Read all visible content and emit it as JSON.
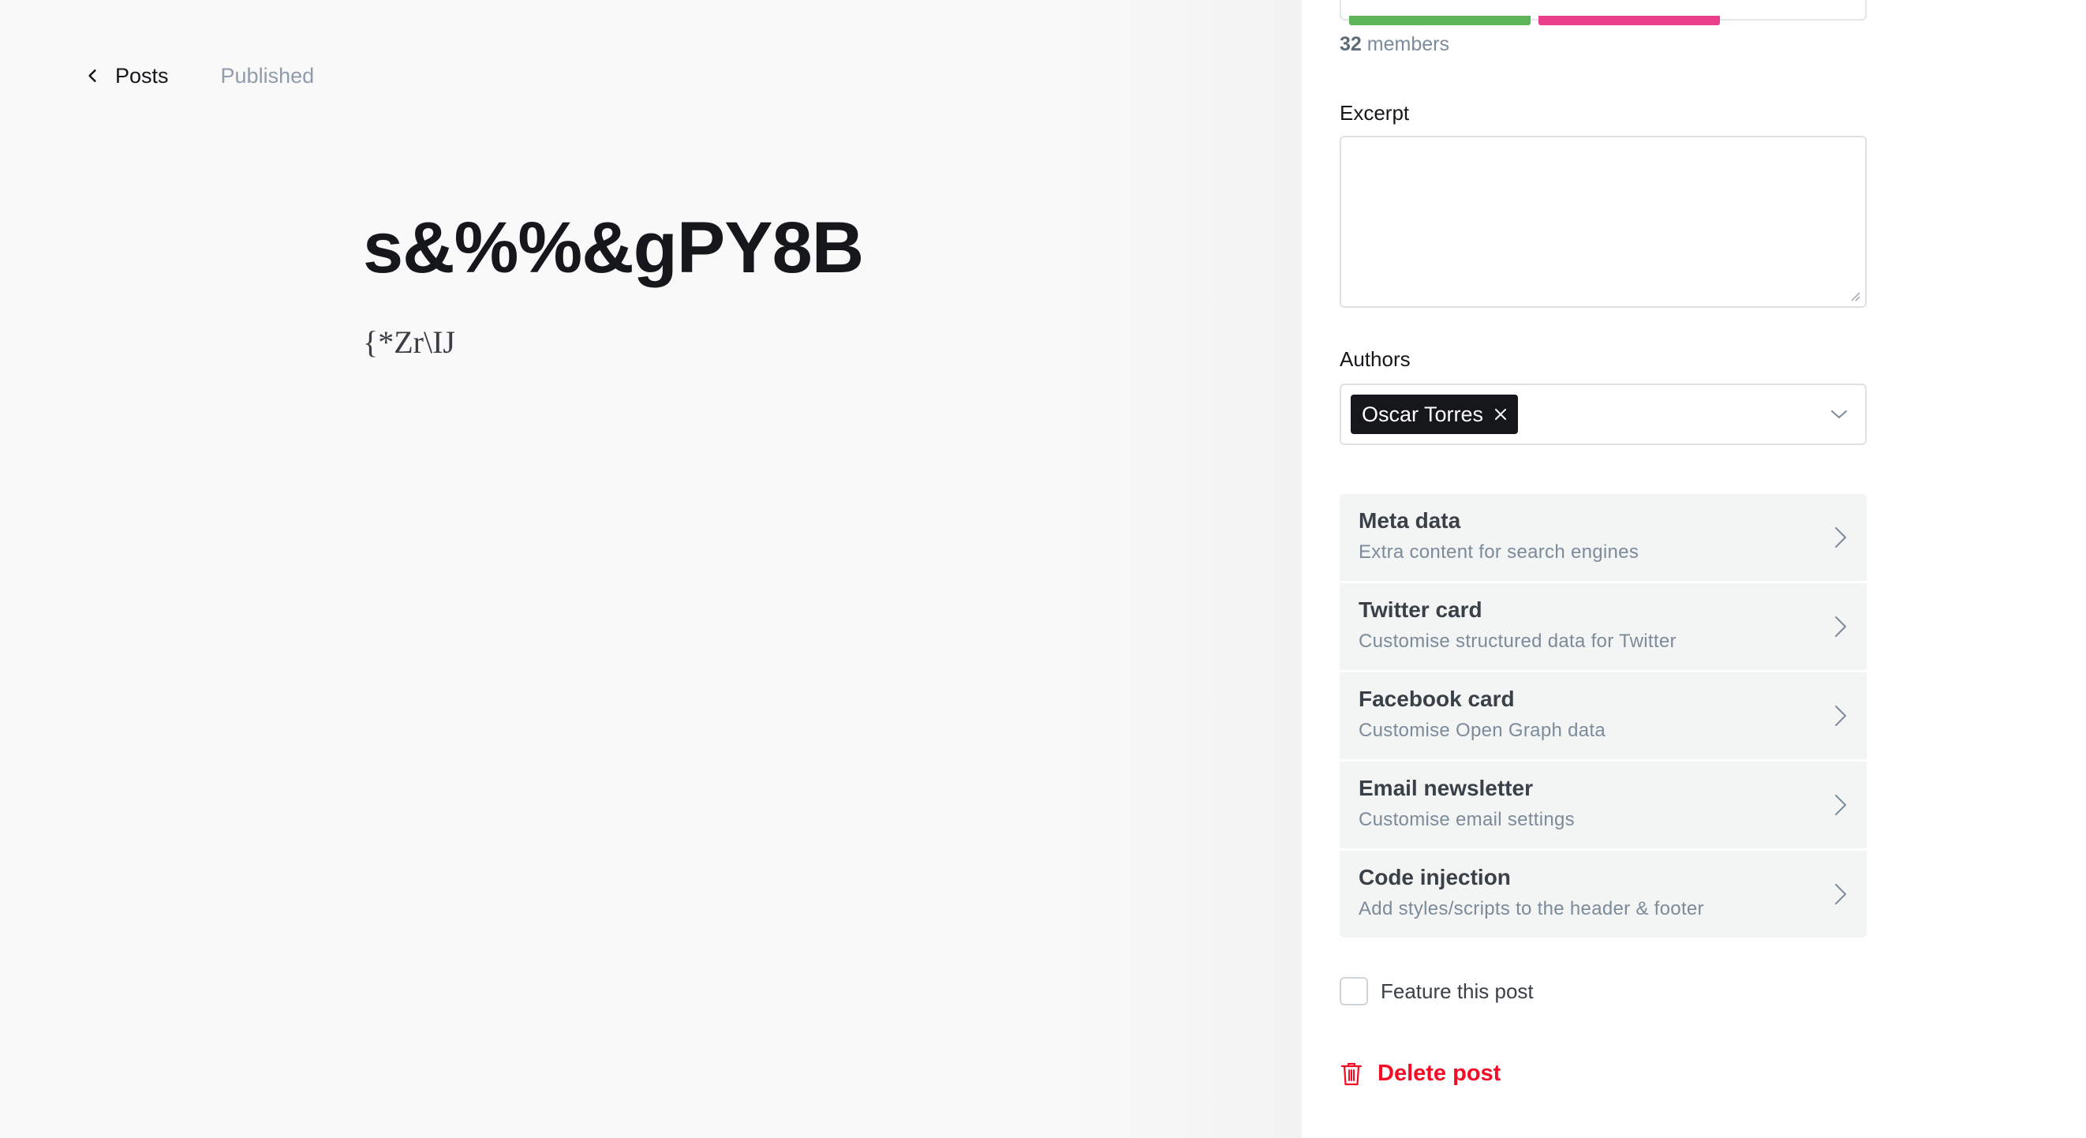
{
  "editor": {
    "back_label": "Posts",
    "status": "Published",
    "title": "s&%%&gPY8B",
    "body": "{*Zr\\IJ"
  },
  "settings": {
    "members": {
      "count": "32",
      "suffix": "members"
    },
    "tier_colors": [
      "#5cb558",
      "#e93f8b"
    ],
    "excerpt": {
      "label": "Excerpt",
      "value": ""
    },
    "authors": {
      "label": "Authors",
      "selected": [
        "Oscar Torres"
      ]
    },
    "nav_items": [
      {
        "title": "Meta data",
        "subtitle": "Extra content for search engines"
      },
      {
        "title": "Twitter card",
        "subtitle": "Customise structured data for Twitter"
      },
      {
        "title": "Facebook card",
        "subtitle": "Customise Open Graph data"
      },
      {
        "title": "Email newsletter",
        "subtitle": "Customise email settings"
      },
      {
        "title": "Code injection",
        "subtitle": "Add styles/scripts to the header & footer"
      }
    ],
    "feature": {
      "label": "Feature this post",
      "checked": false
    },
    "delete_label": "Delete post",
    "danger_color": "#f50b23"
  }
}
